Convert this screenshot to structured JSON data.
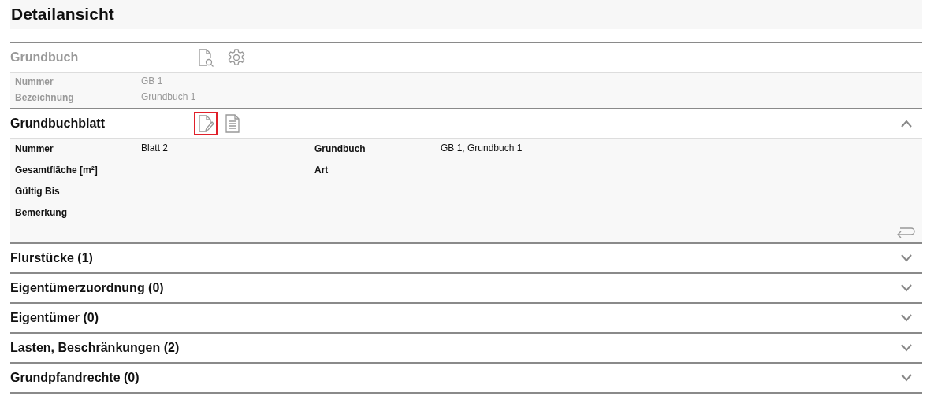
{
  "page_title": "Detailansicht",
  "sections": [
    {
      "kind": "parent",
      "title": "Grundbuch",
      "tools": [
        {
          "kind": "search-doc",
          "selected": false
        },
        {
          "kind": "gear",
          "selected": false
        }
      ],
      "fields": [
        [
          {
            "label": "Nummer",
            "value": "GB 1"
          }
        ],
        [
          {
            "label": "Bezeichnung",
            "value": "Grundbuch 1"
          }
        ]
      ]
    },
    {
      "kind": "panel",
      "title": "Grundbuchblatt",
      "expanded": true,
      "tools": [
        {
          "kind": "edit-doc",
          "selected": true
        },
        {
          "kind": "text-doc",
          "selected": false
        }
      ],
      "fields": [
        [
          {
            "label": "Nummer",
            "value": "Blatt 2"
          },
          {
            "label": "Grundbuch",
            "value": "GB 1, Grundbuch 1"
          }
        ],
        [
          {
            "label": "Gesamtfläche [m²]"
          },
          {
            "label": "Art"
          }
        ],
        [
          {
            "label": "Gültig Bis"
          }
        ],
        [
          {
            "label": "Bemerkung"
          }
        ]
      ]
    },
    {
      "kind": "panel",
      "title": "Flurstücke (1)",
      "expanded": false
    },
    {
      "kind": "panel",
      "title": "Eigentümerzuordnung (0)",
      "expanded": false
    },
    {
      "kind": "panel",
      "title": "Eigentümer (0)",
      "expanded": false
    },
    {
      "kind": "panel",
      "title": "Lasten, Beschränkungen (2)",
      "expanded": false
    },
    {
      "kind": "panel",
      "title": "Grundpfandrechte (0)",
      "expanded": false
    }
  ]
}
